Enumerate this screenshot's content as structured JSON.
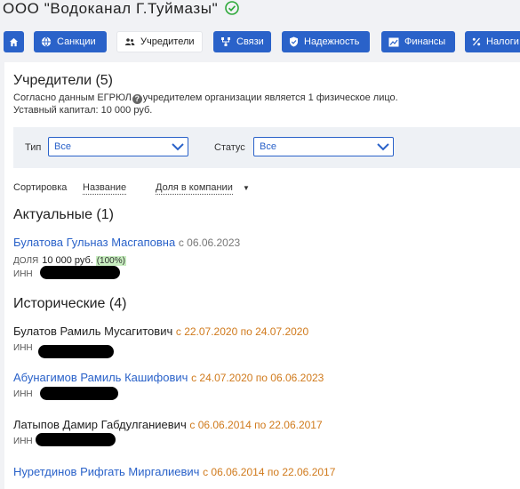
{
  "company": {
    "title": "ООО \"Водоканал Г.Туймазы\"",
    "verified_icon": "check-circle-icon",
    "verified_color": "#2fa93b"
  },
  "tabs": [
    {
      "label": "",
      "icon": "home-icon"
    },
    {
      "label": "Санкции",
      "icon": "globe-icon"
    },
    {
      "label": "Учредители",
      "icon": "users-icon",
      "active": true
    },
    {
      "label": "Связи",
      "icon": "network-icon"
    },
    {
      "label": "Надежность",
      "icon": "shield-icon"
    },
    {
      "label": "Финансы",
      "icon": "chart-icon"
    },
    {
      "label": "Налоги",
      "icon": "percent-icon"
    }
  ],
  "founders": {
    "title": "Учредители (5)",
    "info_before": "Согласно данным ЕГРЮЛ",
    "info_after": "учредителем организации является 1 физическое лицо.",
    "capital": "Уставный капитал: 10 000 руб."
  },
  "filters": {
    "type_label": "Тип",
    "type_value": "Все",
    "status_label": "Статус",
    "status_value": "Все"
  },
  "sort": {
    "label": "Сортировка",
    "by_name": "Название",
    "by_share": "Доля в компании"
  },
  "current": {
    "title": "Актуальные (1)",
    "person": {
      "name": "Булатова Гульназ Масгаповна",
      "since": "с 06.06.2023",
      "share_label": "ДОЛЯ",
      "share_value": "10 000 руб.",
      "share_pct": "(100%)",
      "inn_label": "ИНН"
    }
  },
  "historic": {
    "title": "Исторические (4)",
    "people": [
      {
        "name": "Булатов Рамиль Мусагитович",
        "period": "с 22.07.2020 по 24.07.2020",
        "inn_label": "ИНН"
      },
      {
        "name": "Абунагимов Рамиль Кашифович",
        "period": "с 24.07.2020 по 06.06.2023",
        "inn_label": "ИНН"
      },
      {
        "name": "Латыпов Дамир Габдулганиевич",
        "period": "с 06.06.2014 по 22.06.2017",
        "inn_label": "ИНН"
      },
      {
        "name": "Нуретдинов Рифгать Миргалиевич",
        "period": "с 06.06.2014 по 22.06.2017"
      }
    ]
  }
}
